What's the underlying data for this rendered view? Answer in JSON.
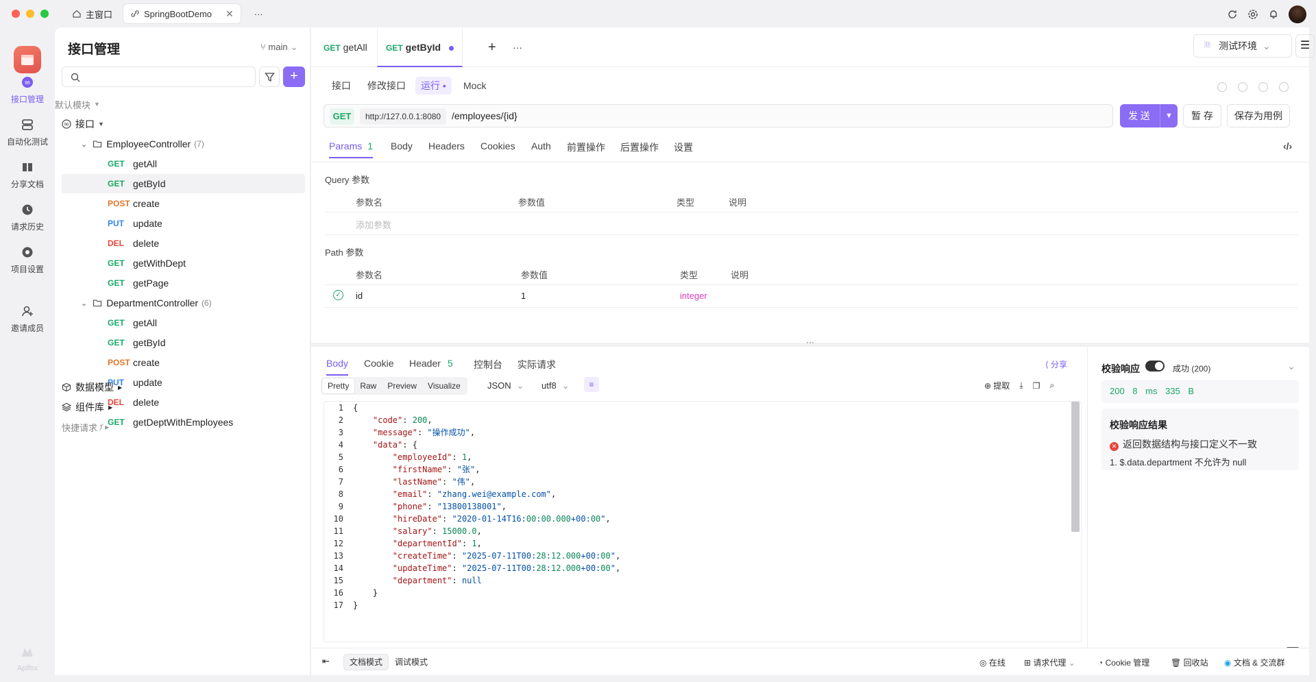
{
  "titlebar": {
    "tabs": [
      {
        "label": "主窗口"
      },
      {
        "label": "SpringBootDemo"
      }
    ],
    "more": "···"
  },
  "rail": {
    "items": [
      {
        "label": "接口管理",
        "icon": "api-management-icon"
      },
      {
        "label": "自动化测试",
        "icon": "automation-test-icon"
      },
      {
        "label": "分享文档",
        "icon": "share-docs-icon"
      },
      {
        "label": "请求历史",
        "icon": "history-icon"
      },
      {
        "label": "项目设置",
        "icon": "settings-icon"
      },
      {
        "label": "邀请成员",
        "icon": "invite-member-icon"
      }
    ],
    "brand": "Apifox"
  },
  "left": {
    "title": "接口管理",
    "branch": "main",
    "default_module": "默认模块",
    "api_root": "接口",
    "controllers": [
      {
        "name": "EmployeeController",
        "count": "(7)",
        "endpoints": [
          {
            "method": "GET",
            "name": "getAll"
          },
          {
            "method": "GET",
            "name": "getById"
          },
          {
            "method": "POST",
            "name": "create"
          },
          {
            "method": "PUT",
            "name": "update"
          },
          {
            "method": "DEL",
            "name": "delete"
          },
          {
            "method": "GET",
            "name": "getWithDept"
          },
          {
            "method": "GET",
            "name": "getPage"
          }
        ]
      },
      {
        "name": "DepartmentController",
        "count": "(6)",
        "endpoints": [
          {
            "method": "GET",
            "name": "getAll"
          },
          {
            "method": "GET",
            "name": "getById"
          },
          {
            "method": "POST",
            "name": "create"
          },
          {
            "method": "PUT",
            "name": "update"
          },
          {
            "method": "DEL",
            "name": "delete"
          },
          {
            "method": "GET",
            "name": "getDeptWithEmployees"
          }
        ]
      }
    ],
    "data_model": "数据模型",
    "components": "组件库",
    "quick_request": "快捷请求"
  },
  "main": {
    "tabs": [
      {
        "method": "GET",
        "label": "getAll"
      },
      {
        "method": "GET",
        "label": "getById"
      }
    ],
    "plus": "+",
    "more": "···",
    "env": "测试环境",
    "subtabs": [
      "接口",
      "修改接口",
      "运行",
      "Mock"
    ],
    "request": {
      "method": "GET",
      "base": "http://127.0.0.1:8080",
      "path": "/employees/{id}",
      "send": "发 送",
      "save": "暂 存",
      "save_case": "保存为用例"
    },
    "param_tabs": [
      "Params",
      "Body",
      "Headers",
      "Cookies",
      "Auth",
      "前置操作",
      "后置操作",
      "设置"
    ],
    "params_count": "1",
    "query_title": "Query 参数",
    "columns": [
      "参数名",
      "参数值",
      "类型",
      "说明"
    ],
    "add_param": "添加参数",
    "path_title": "Path 参数",
    "path_param": {
      "name": "id",
      "value": "1",
      "type": "integer"
    },
    "splitter": "···"
  },
  "response": {
    "tabs": [
      "Body",
      "Cookie",
      "Header",
      "控制台",
      "实际请求"
    ],
    "header_count": "5",
    "share": "分享",
    "formats": [
      "Pretty",
      "Raw",
      "Preview",
      "Visualize"
    ],
    "lang": "JSON",
    "encoding": "utf8",
    "extract": "提取",
    "lines": [
      "{",
      "    \"code\": 200,",
      "    \"message\": \"操作成功\",",
      "    \"data\": {",
      "        \"employeeId\": 1,",
      "        \"firstName\": \"张\",",
      "        \"lastName\": \"伟\",",
      "        \"email\": \"zhang.wei@example.com\",",
      "        \"phone\": \"13800138001\",",
      "        \"hireDate\": \"2020-01-14T16:00:00.000+00:00\",",
      "        \"salary\": 15000.0,",
      "        \"departmentId\": 1,",
      "        \"createTime\": \"2025-07-11T00:28:12.000+00:00\",",
      "        \"updateTime\": \"2025-07-11T00:28:12.000+00:00\",",
      "        \"department\": null",
      "    }",
      "}"
    ]
  },
  "validation": {
    "title": "校验响应",
    "status": "成功 (200)",
    "stats": "200  8 ms  335 B",
    "result_title": "校验响应结果",
    "error": "返回数据结构与接口定义不一致",
    "detail": "1. $.data.department 不允许为 null"
  },
  "bottom": {
    "modes": [
      "文档模式",
      "调试模式"
    ],
    "items": [
      "在线",
      "请求代理",
      "Cookie 管理",
      "回收站",
      "文档 & 交流群"
    ]
  }
}
